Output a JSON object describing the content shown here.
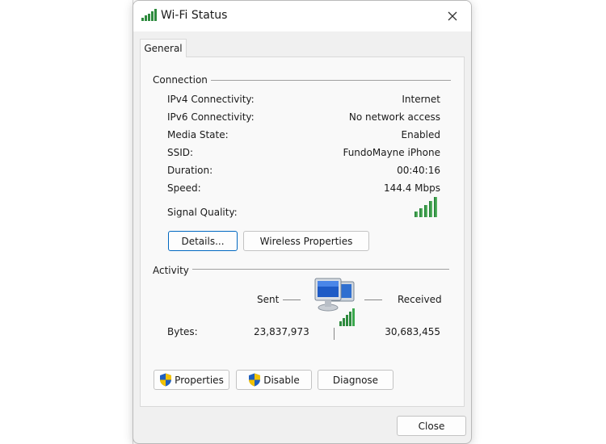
{
  "window": {
    "title": "Wi-Fi Status",
    "title_icon": "wifi-signal-icon",
    "close_icon": "close-icon"
  },
  "tabs": [
    {
      "label": "General",
      "active": true
    }
  ],
  "connection": {
    "group_label": "Connection",
    "rows": [
      {
        "label": "IPv4 Connectivity:",
        "value": "Internet"
      },
      {
        "label": "IPv6 Connectivity:",
        "value": "No network access"
      },
      {
        "label": "Media State:",
        "value": "Enabled"
      },
      {
        "label": "SSID:",
        "value": "FundoMayne iPhone"
      },
      {
        "label": "Duration:",
        "value": "00:40:16"
      },
      {
        "label": "Speed:",
        "value": "144.4 Mbps"
      }
    ],
    "signal_quality_label": "Signal Quality:",
    "signal_quality_bars": 5,
    "signal_quality_max_bars": 5,
    "details_button": {
      "label": "Details...",
      "accel": "D"
    },
    "wireless_properties_button": {
      "label": "Wireless Properties",
      "accel": "W"
    }
  },
  "activity": {
    "group_label": "Activity",
    "sent_label": "Sent",
    "received_label": "Received",
    "bytes_label": "Bytes:",
    "bytes_sent": "23,837,973",
    "bytes_received": "30,683,455",
    "network_icon": "network-computers-icon"
  },
  "buttons": {
    "properties": {
      "label": "Properties",
      "accel": "P",
      "icon": "shield-icon"
    },
    "disable": {
      "label": "Disable",
      "accel": "D",
      "icon": "shield-icon"
    },
    "diagnose": {
      "label": "Diagnose"
    },
    "close": {
      "label": "Close",
      "accel": "C"
    }
  },
  "colors": {
    "signal_green": "#2e8b3e",
    "focus_blue": "#0067c0"
  }
}
